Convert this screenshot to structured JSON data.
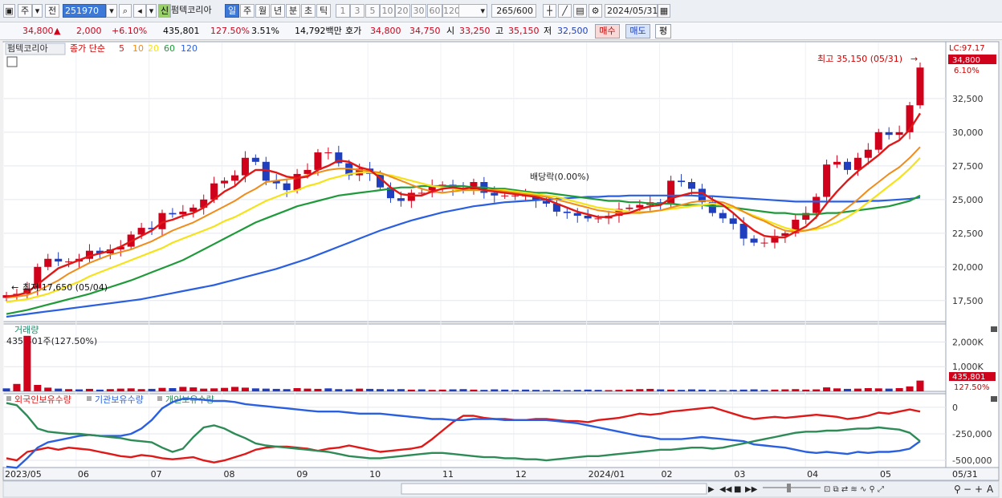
{
  "toolbar": {
    "market_code": "주",
    "jeon": "전",
    "code": "251970",
    "sin": "신",
    "stock_name": "펌텍코리아",
    "periods": [
      "일",
      "주",
      "월",
      "년",
      "분",
      "초",
      "틱"
    ],
    "active_period": "일",
    "minute_steps": [
      "1",
      "3",
      "5",
      "10",
      "20",
      "30",
      "60",
      "120"
    ],
    "count": "265",
    "count_total": "/600",
    "date": "2024/05/31"
  },
  "quote": {
    "price": "34,800",
    "change": "2,000",
    "change_pct": "+6.10%",
    "volume": "435,801",
    "volume_ratio": "127.50%",
    "turnover": "3.51%",
    "amount": "14,792백만",
    "hoga_label": "호가",
    "ask": "34,800",
    "bid": "34,750",
    "open_label": "시",
    "open": "33,250",
    "high_label": "고",
    "high": "35,150",
    "low_label": "저",
    "low": "32,500",
    "buy_label": "매수",
    "sell_label": "매도",
    "avg_label": "평"
  },
  "colors": {
    "up": "#d0021b",
    "down": "#1f3fbf",
    "ma5": "#e01818",
    "ma10": "#f08c1a",
    "ma20": "#f5e21a",
    "ma60": "#1f9a3a",
    "ma120": "#2a5fe0"
  },
  "chart_data": [
    {
      "type": "line",
      "panel": "price",
      "legend_name": "펌텍코리아",
      "legend_label": "종가 단순",
      "ma_labels": [
        "5",
        "10",
        "20",
        "60",
        "120"
      ],
      "ylim": [
        16000,
        36600
      ],
      "y_ticks": [
        17500,
        20000,
        22500,
        25000,
        27500,
        30000,
        32500
      ],
      "y_tick_labels": [
        "17,500",
        "20,000",
        "22,500",
        "25,000",
        "27,500",
        "30,000",
        "32,500"
      ],
      "lc_label": "LC:97.17",
      "last_price_label": "34,800",
      "last_pct_label": "6.10%",
      "high_annotation": "최고 35,150 (05/31)",
      "low_annotation": "최저 17,650 (05/04)",
      "dividend_annotation": "배당락(0.00%)",
      "x_labels": [
        "2023/05",
        "06",
        "07",
        "08",
        "09",
        "10",
        "11",
        "12",
        "2024/01",
        "02",
        "03",
        "04",
        "05",
        "05/31"
      ],
      "close": [
        17900,
        18000,
        18400,
        20000,
        20600,
        20400,
        20400,
        20600,
        21200,
        21000,
        21300,
        21500,
        22400,
        22900,
        22800,
        24000,
        23900,
        24100,
        24400,
        25000,
        26200,
        26400,
        26800,
        28100,
        27800,
        26400,
        26200,
        25700,
        26900,
        27200,
        28500,
        28500,
        27700,
        26800,
        27300,
        26900,
        25900,
        25100,
        24900,
        25500,
        25500,
        26000,
        26100,
        25800,
        25700,
        26300,
        25500,
        25300,
        25300,
        25300,
        25300,
        24900,
        24700,
        24100,
        24000,
        23800,
        23600,
        23600,
        23800,
        24300,
        24400,
        24600,
        24800,
        24700,
        26400,
        26300,
        25800,
        24800,
        24000,
        23600,
        23200,
        22100,
        21800,
        21800,
        22300,
        22500,
        23500,
        24000,
        25200,
        27600,
        27800,
        27200,
        28100,
        28700,
        30000,
        29800,
        30000,
        32000,
        34800
      ],
      "ma5": [
        17800,
        17900,
        18100,
        18700,
        19300,
        19900,
        20200,
        20500,
        20800,
        21000,
        21200,
        21500,
        21900,
        22300,
        22700,
        23300,
        23500,
        23800,
        24000,
        24400,
        25000,
        25600,
        26000,
        26700,
        27200,
        27200,
        27000,
        26700,
        26600,
        26700,
        27200,
        27500,
        27900,
        27800,
        27400,
        27200,
        26600,
        25900,
        25400,
        25300,
        25300,
        25600,
        25800,
        25900,
        25800,
        25900,
        25700,
        25600,
        25500,
        25400,
        25300,
        25200,
        25000,
        24700,
        24400,
        24100,
        23900,
        23700,
        23700,
        23900,
        24000,
        24300,
        24500,
        24600,
        25100,
        25300,
        25500,
        25500,
        25000,
        24600,
        24000,
        23300,
        22700,
        22300,
        22200,
        22200,
        22600,
        23000,
        23700,
        24700,
        25600,
        26400,
        27100,
        27700,
        28300,
        29000,
        29400,
        30200,
        31400
      ],
      "ma10": [
        17700,
        17800,
        17900,
        18200,
        18600,
        19000,
        19500,
        19900,
        20300,
        20600,
        20900,
        21100,
        21300,
        21600,
        21900,
        22300,
        22700,
        23000,
        23300,
        23700,
        24100,
        24500,
        24900,
        25400,
        25800,
        26300,
        26400,
        26500,
        26600,
        26800,
        27000,
        27200,
        27300,
        27300,
        27200,
        27100,
        27000,
        26700,
        26400,
        26100,
        25800,
        25600,
        25500,
        25600,
        25700,
        25700,
        25700,
        25700,
        25600,
        25500,
        25400,
        25300,
        25200,
        25000,
        24800,
        24600,
        24400,
        24200,
        24100,
        24000,
        24000,
        24000,
        24100,
        24200,
        24400,
        24600,
        24800,
        24900,
        24900,
        24800,
        24500,
        24100,
        23700,
        23400,
        23000,
        22700,
        22600,
        22700,
        22900,
        23300,
        23800,
        24400,
        25000,
        25700,
        26300,
        26900,
        27400,
        28100,
        28900
      ],
      "ma20": [
        17400,
        17500,
        17600,
        17800,
        18000,
        18300,
        18600,
        18900,
        19300,
        19600,
        19900,
        20200,
        20500,
        20800,
        21100,
        21400,
        21800,
        22100,
        22400,
        22700,
        23000,
        23400,
        23700,
        24100,
        24500,
        24900,
        25200,
        25500,
        25700,
        26000,
        26200,
        26500,
        26700,
        26900,
        27000,
        27000,
        26900,
        26800,
        26600,
        26400,
        26200,
        26000,
        25900,
        25800,
        25700,
        25700,
        25700,
        25700,
        25700,
        25600,
        25500,
        25400,
        25300,
        25200,
        25000,
        24800,
        24600,
        24400,
        24300,
        24200,
        24100,
        24100,
        24100,
        24200,
        24300,
        24400,
        24500,
        24600,
        24700,
        24600,
        24400,
        24100,
        23800,
        23500,
        23200,
        22900,
        22700,
        22700,
        22800,
        23000,
        23300,
        23700,
        24200,
        24800,
        25400,
        26000,
        26600,
        27300,
        28100
      ],
      "ma60": [
        16500,
        16650,
        16800,
        17000,
        17200,
        17400,
        17600,
        17800,
        18000,
        18250,
        18500,
        18750,
        19000,
        19300,
        19600,
        19900,
        20200,
        20500,
        20900,
        21300,
        21700,
        22100,
        22500,
        22900,
        23300,
        23600,
        23900,
        24200,
        24500,
        24700,
        24900,
        25100,
        25300,
        25400,
        25500,
        25600,
        25700,
        25800,
        25900,
        25900,
        26000,
        26000,
        26000,
        26000,
        26000,
        25900,
        25900,
        25800,
        25800,
        25700,
        25600,
        25500,
        25500,
        25400,
        25300,
        25200,
        25100,
        25000,
        24900,
        24900,
        24800,
        24800,
        24700,
        24700,
        24700,
        24600,
        24600,
        24600,
        24500,
        24500,
        24400,
        24300,
        24200,
        24100,
        24000,
        24000,
        23900,
        23900,
        23900,
        24000,
        24000,
        24100,
        24200,
        24300,
        24400,
        24500,
        24700,
        24900,
        25300
      ],
      "ma120": [
        16300,
        16400,
        16500,
        16600,
        16700,
        16800,
        16900,
        17000,
        17100,
        17200,
        17300,
        17400,
        17500,
        17600,
        17750,
        17900,
        18050,
        18200,
        18350,
        18500,
        18650,
        18850,
        19050,
        19250,
        19450,
        19650,
        19850,
        20100,
        20350,
        20600,
        20900,
        21200,
        21500,
        21800,
        22100,
        22400,
        22700,
        22950,
        23200,
        23450,
        23650,
        23850,
        24050,
        24200,
        24350,
        24500,
        24600,
        24700,
        24800,
        24850,
        24900,
        24950,
        25000,
        25050,
        25100,
        25150,
        25200,
        25200,
        25250,
        25250,
        25300,
        25300,
        25300,
        25300,
        25300,
        25300,
        25300,
        25250,
        25250,
        25200,
        25150,
        25100,
        25050,
        25000,
        24950,
        24900,
        24850,
        24850,
        24850,
        24850,
        24850,
        24850,
        24850,
        24900,
        24900,
        24950,
        25000,
        25050,
        25150
      ]
    },
    {
      "type": "bar",
      "panel": "volume",
      "legend_name": "거래량",
      "current_label": "435,801주(127.50%)",
      "ylim": [
        0,
        2600000
      ],
      "y_ticks": [
        1000000,
        2000000
      ],
      "y_tick_labels": [
        "1,000K",
        "2,000K"
      ],
      "last_label": "435,801",
      "last_pct_label": "127.50%",
      "values": [
        120000,
        300000,
        2250000,
        260000,
        150000,
        110000,
        90000,
        80000,
        100000,
        70000,
        90000,
        110000,
        120000,
        90000,
        100000,
        140000,
        130000,
        180000,
        160000,
        110000,
        120000,
        140000,
        180000,
        150000,
        120000,
        110000,
        100000,
        90000,
        130000,
        110000,
        100000,
        120000,
        90000,
        80000,
        110000,
        100000,
        90000,
        80000,
        90000,
        70000,
        80000,
        60000,
        70000,
        80000,
        90000,
        70000,
        60000,
        80000,
        70000,
        60000,
        70000,
        60000,
        50000,
        60000,
        50000,
        60000,
        70000,
        60000,
        50000,
        60000,
        70000,
        90000,
        100000,
        80000,
        70000,
        60000,
        80000,
        70000,
        60000,
        50000,
        60000,
        70000,
        80000,
        60000,
        70000,
        80000,
        90000,
        70000,
        80000,
        160000,
        120000,
        100000,
        110000,
        130000,
        120000,
        110000,
        130000,
        200000,
        435801
      ],
      "up": [
        false,
        true,
        true,
        true,
        true,
        false,
        true,
        false,
        true,
        false,
        true,
        true,
        true,
        true,
        false,
        true,
        false,
        true,
        true,
        true,
        true,
        true,
        true,
        true,
        false,
        false,
        false,
        false,
        true,
        true,
        true,
        false,
        false,
        false,
        true,
        false,
        false,
        false,
        false,
        true,
        false,
        true,
        true,
        false,
        false,
        true,
        false,
        false,
        false,
        false,
        false,
        false,
        false,
        false,
        false,
        false,
        false,
        false,
        true,
        true,
        true,
        true,
        true,
        false,
        true,
        false,
        false,
        false,
        false,
        false,
        false,
        false,
        false,
        false,
        true,
        true,
        true,
        true,
        true,
        true,
        true,
        false,
        true,
        true,
        true,
        false,
        true,
        true,
        true
      ]
    },
    {
      "type": "line",
      "panel": "holdings",
      "series_names": [
        "외국인보유수량",
        "기관보유수량",
        "개인보유수량"
      ],
      "ylim": [
        -560000,
        90000
      ],
      "y_ticks": [
        0,
        -250000,
        -500000
      ],
      "y_tick_labels": [
        "0",
        "-250,000",
        "-500,000"
      ],
      "foreign": [
        -480000,
        -500000,
        -420000,
        -400000,
        -380000,
        -400000,
        -380000,
        -390000,
        -400000,
        -420000,
        -440000,
        -460000,
        -470000,
        -450000,
        -460000,
        -480000,
        -490000,
        -480000,
        -470000,
        -500000,
        -520000,
        -500000,
        -470000,
        -440000,
        -400000,
        -380000,
        -370000,
        -370000,
        -380000,
        -390000,
        -410000,
        -390000,
        -380000,
        -360000,
        -380000,
        -400000,
        -420000,
        -410000,
        -400000,
        -390000,
        -370000,
        -300000,
        -220000,
        -140000,
        -80000,
        -80000,
        -100000,
        -110000,
        -110000,
        -120000,
        -120000,
        -110000,
        -110000,
        -120000,
        -130000,
        -130000,
        -140000,
        -120000,
        -110000,
        -100000,
        -80000,
        -60000,
        -70000,
        -60000,
        -40000,
        -30000,
        -20000,
        -10000,
        0,
        -30000,
        -60000,
        -90000,
        -110000,
        -100000,
        -90000,
        -100000,
        -90000,
        -80000,
        -70000,
        -80000,
        -90000,
        -110000,
        -100000,
        -80000,
        -50000,
        -60000,
        -40000,
        -20000,
        -40000
      ],
      "institution": [
        -560000,
        -570000,
        -480000,
        -380000,
        -330000,
        -310000,
        -290000,
        -270000,
        -260000,
        -270000,
        -270000,
        -270000,
        -250000,
        -200000,
        -120000,
        -10000,
        50000,
        80000,
        80000,
        70000,
        60000,
        60000,
        50000,
        30000,
        20000,
        10000,
        0,
        -10000,
        -20000,
        -30000,
        -40000,
        -40000,
        -40000,
        -50000,
        -60000,
        -60000,
        -60000,
        -70000,
        -80000,
        -90000,
        -100000,
        -110000,
        -110000,
        -120000,
        -120000,
        -110000,
        -110000,
        -110000,
        -120000,
        -120000,
        -120000,
        -120000,
        -120000,
        -130000,
        -140000,
        -150000,
        -170000,
        -190000,
        -210000,
        -230000,
        -250000,
        -270000,
        -280000,
        -300000,
        -300000,
        -300000,
        -290000,
        -280000,
        -290000,
        -300000,
        -310000,
        -320000,
        -350000,
        -360000,
        -370000,
        -380000,
        -400000,
        -420000,
        -430000,
        -420000,
        -430000,
        -440000,
        -420000,
        -430000,
        -420000,
        -420000,
        -410000,
        -390000,
        -320000
      ],
      "individual": [
        40000,
        20000,
        -80000,
        -200000,
        -230000,
        -240000,
        -250000,
        -250000,
        -260000,
        -270000,
        -280000,
        -290000,
        -310000,
        -320000,
        -330000,
        -380000,
        -420000,
        -390000,
        -280000,
        -190000,
        -170000,
        -200000,
        -250000,
        -290000,
        -340000,
        -360000,
        -370000,
        -380000,
        -390000,
        -400000,
        -410000,
        -420000,
        -440000,
        -460000,
        -470000,
        -480000,
        -480000,
        -470000,
        -460000,
        -450000,
        -440000,
        -430000,
        -430000,
        -440000,
        -450000,
        -460000,
        -470000,
        -470000,
        -480000,
        -480000,
        -490000,
        -490000,
        -500000,
        -490000,
        -480000,
        -470000,
        -460000,
        -460000,
        -450000,
        -440000,
        -430000,
        -420000,
        -410000,
        -400000,
        -400000,
        -390000,
        -380000,
        -380000,
        -390000,
        -380000,
        -360000,
        -340000,
        -320000,
        -300000,
        -280000,
        -260000,
        -240000,
        -230000,
        -230000,
        -220000,
        -220000,
        -210000,
        -200000,
        -200000,
        -190000,
        -200000,
        -210000,
        -240000,
        -320000
      ]
    }
  ],
  "bottom_controls": [
    "play",
    "prev",
    "stop",
    "next",
    "zoom-out",
    "zoom-in",
    "plus",
    "A"
  ]
}
